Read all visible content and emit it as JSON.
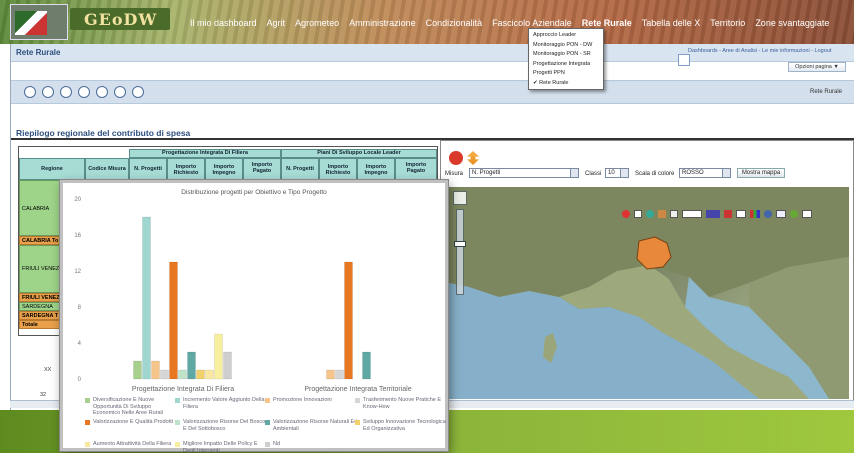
{
  "header": {
    "logo_text": "GEoDW",
    "nav": [
      {
        "label": "Il mio dashboard",
        "active": false
      },
      {
        "label": "Agrit",
        "active": false
      },
      {
        "label": "Agrometeo",
        "active": false
      },
      {
        "label": "Amministrazione",
        "active": false
      },
      {
        "label": "Condizionalità",
        "active": false
      },
      {
        "label": "Fascicolo Aziendale",
        "active": false
      },
      {
        "label": "Rete Rurale",
        "active": true
      },
      {
        "label": "Tabella delle X",
        "active": false
      },
      {
        "label": "Territorio",
        "active": false
      },
      {
        "label": "Zone svantaggiate",
        "active": false
      }
    ]
  },
  "dropdown": {
    "items": [
      "Approccio Leader",
      "Monitoraggio PON - DW",
      "Monitoraggio PON - SR",
      "Progettazione Integrata",
      "Progetti PPN",
      "✔ Rete Rurale"
    ]
  },
  "page": {
    "title": "Rete Rurale",
    "top_links": "Dashboards - Aree di Analisi - Le mie informazioni - Logout",
    "options_button": "Opzioni pagina ▼",
    "toolbar_right": "Rete Rurale",
    "section_title": "Riepilogo regionale del contributo di spesa"
  },
  "table": {
    "group_headers": [
      "Progettazione Integrata Di Filiera",
      "Piani Di Sviluppo Locale Leader"
    ],
    "columns": [
      "Regione",
      "Codice Misura",
      "N. Progetti",
      "Importo Richiesto",
      "Importo Impegno",
      "Importo Pagato",
      "N. Progetti",
      "Importo Richiesto",
      "Importo Impegno",
      "Importo Pagato"
    ],
    "regions": [
      "CALABRIA",
      "CALABRIA To",
      "FRIULI VENEZ",
      "FRIULI VENEZ",
      "SARDEGNA",
      "SARDEGNA T",
      "Totale"
    ],
    "footer_vals": [
      "XX",
      "32"
    ]
  },
  "chart": {
    "chart_data": {
      "type": "bar",
      "title": "Distribuzione progetti per Obiettivo e Tipo Progetto",
      "categories": [
        "Progettazione Integrata Di Filiera",
        "Progettazione Integrata Territoriale"
      ],
      "ylim": [
        0,
        20
      ],
      "yticks": [
        0,
        4,
        8,
        12,
        16,
        20
      ],
      "grid": false,
      "legend_position": "bottom",
      "series": [
        {
          "name": "Diversificazione E Nuove Opportunità Di Sviluppo Economico Nelle Aree Rurali",
          "color": "#a8d08d",
          "values": [
            2,
            0
          ]
        },
        {
          "name": "Incremento Valore Aggiunto Della Filiera",
          "color": "#9fd6d0",
          "values": [
            18,
            0
          ]
        },
        {
          "name": "Promozione Innovazioni",
          "color": "#f6c58c",
          "values": [
            2,
            1
          ]
        },
        {
          "name": "Trasferimento Nuove Pratiche E Know-How",
          "color": "#d6d6d6",
          "values": [
            1,
            1
          ]
        },
        {
          "name": "Valorizzazione E Qualità Prodotti",
          "color": "#e87722",
          "values": [
            13,
            13
          ]
        },
        {
          "name": "Valorizzazione Risorse Del Bosco E Del Sottobosco",
          "color": "#bfe3c8",
          "values": [
            1,
            0
          ]
        },
        {
          "name": "Valorizzazione Risorse Naturali Ed Ambientali",
          "color": "#5fa8a4",
          "values": [
            3,
            3
          ]
        },
        {
          "name": "Sviluppo Innovazione Tecnologica Ed Organizzativa",
          "color": "#f2d16b",
          "values": [
            1,
            0
          ]
        },
        {
          "name": "Aumento Attrattività Della Filiera",
          "color": "#fbe8a0",
          "values": [
            1,
            0
          ]
        },
        {
          "name": "Migliore Impatto Delle Policy E Degli Interventi",
          "color": "#f7ef9e",
          "values": [
            5,
            0
          ]
        },
        {
          "name": "Nd",
          "color": "#cfcfcf",
          "values": [
            3,
            0
          ]
        }
      ]
    }
  },
  "map": {
    "misura_label": "Misura",
    "misura_value": "N. Progetti",
    "classi_label": "Classi",
    "classi_value": "10",
    "scala_label": "Scala di colore",
    "scala_value": "ROSSO",
    "mostra_label": "Mostra mappa"
  }
}
